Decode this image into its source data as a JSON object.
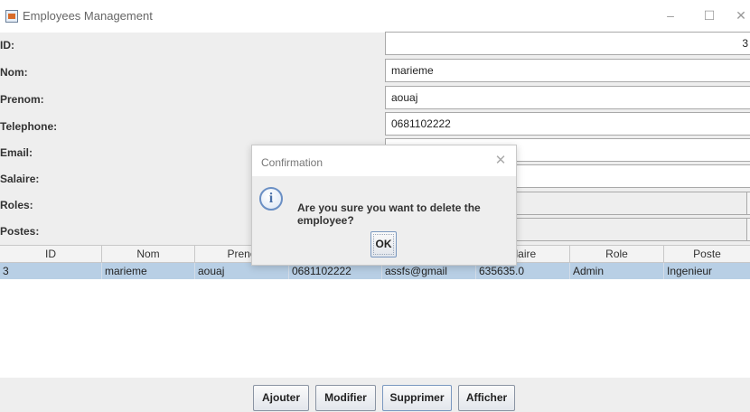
{
  "window": {
    "title": "Employees Management",
    "minimize_glyph": "–",
    "maximize_glyph": "☐",
    "close_glyph": "✕"
  },
  "form": {
    "id_label": "ID:",
    "id_value": "3",
    "nom_label": "Nom:",
    "nom_value": "marieme",
    "prenom_label": "Prenom:",
    "prenom_value": "aouaj",
    "telephone_label": "Telephone:",
    "telephone_value": "0681102222",
    "email_label": "Email:",
    "email_value": "",
    "salaire_label": "Salaire:",
    "salaire_value": "",
    "roles_label": "Roles:",
    "roles_value": "",
    "postes_label": "Postes:",
    "postes_value": ""
  },
  "table": {
    "columns": [
      "ID",
      "Nom",
      "Prenom",
      "",
      "",
      "Salaire",
      "Role",
      "Poste"
    ],
    "column_visible": [
      "ID",
      "Nom",
      "Preno",
      "",
      "",
      "alaire",
      "Role",
      "Poste"
    ],
    "rows": [
      [
        "3",
        "marieme",
        "aouaj",
        "0681102222",
        "assfs@gmail",
        "635635.0",
        "Admin",
        "Ingenieur"
      ]
    ],
    "selected_row": 0
  },
  "buttons": {
    "ajouter": "Ajouter",
    "modifier": "Modifier",
    "supprimer": "Supprimer",
    "afficher": "Afficher"
  },
  "dialog": {
    "title": "Confirmation",
    "message": "Are you sure you want to delete the employee?",
    "ok_label": "OK",
    "icon": "info-icon",
    "close_glyph": "✕"
  },
  "colors": {
    "selected_row": "#b8cfe5",
    "background": "#eeeeee"
  }
}
